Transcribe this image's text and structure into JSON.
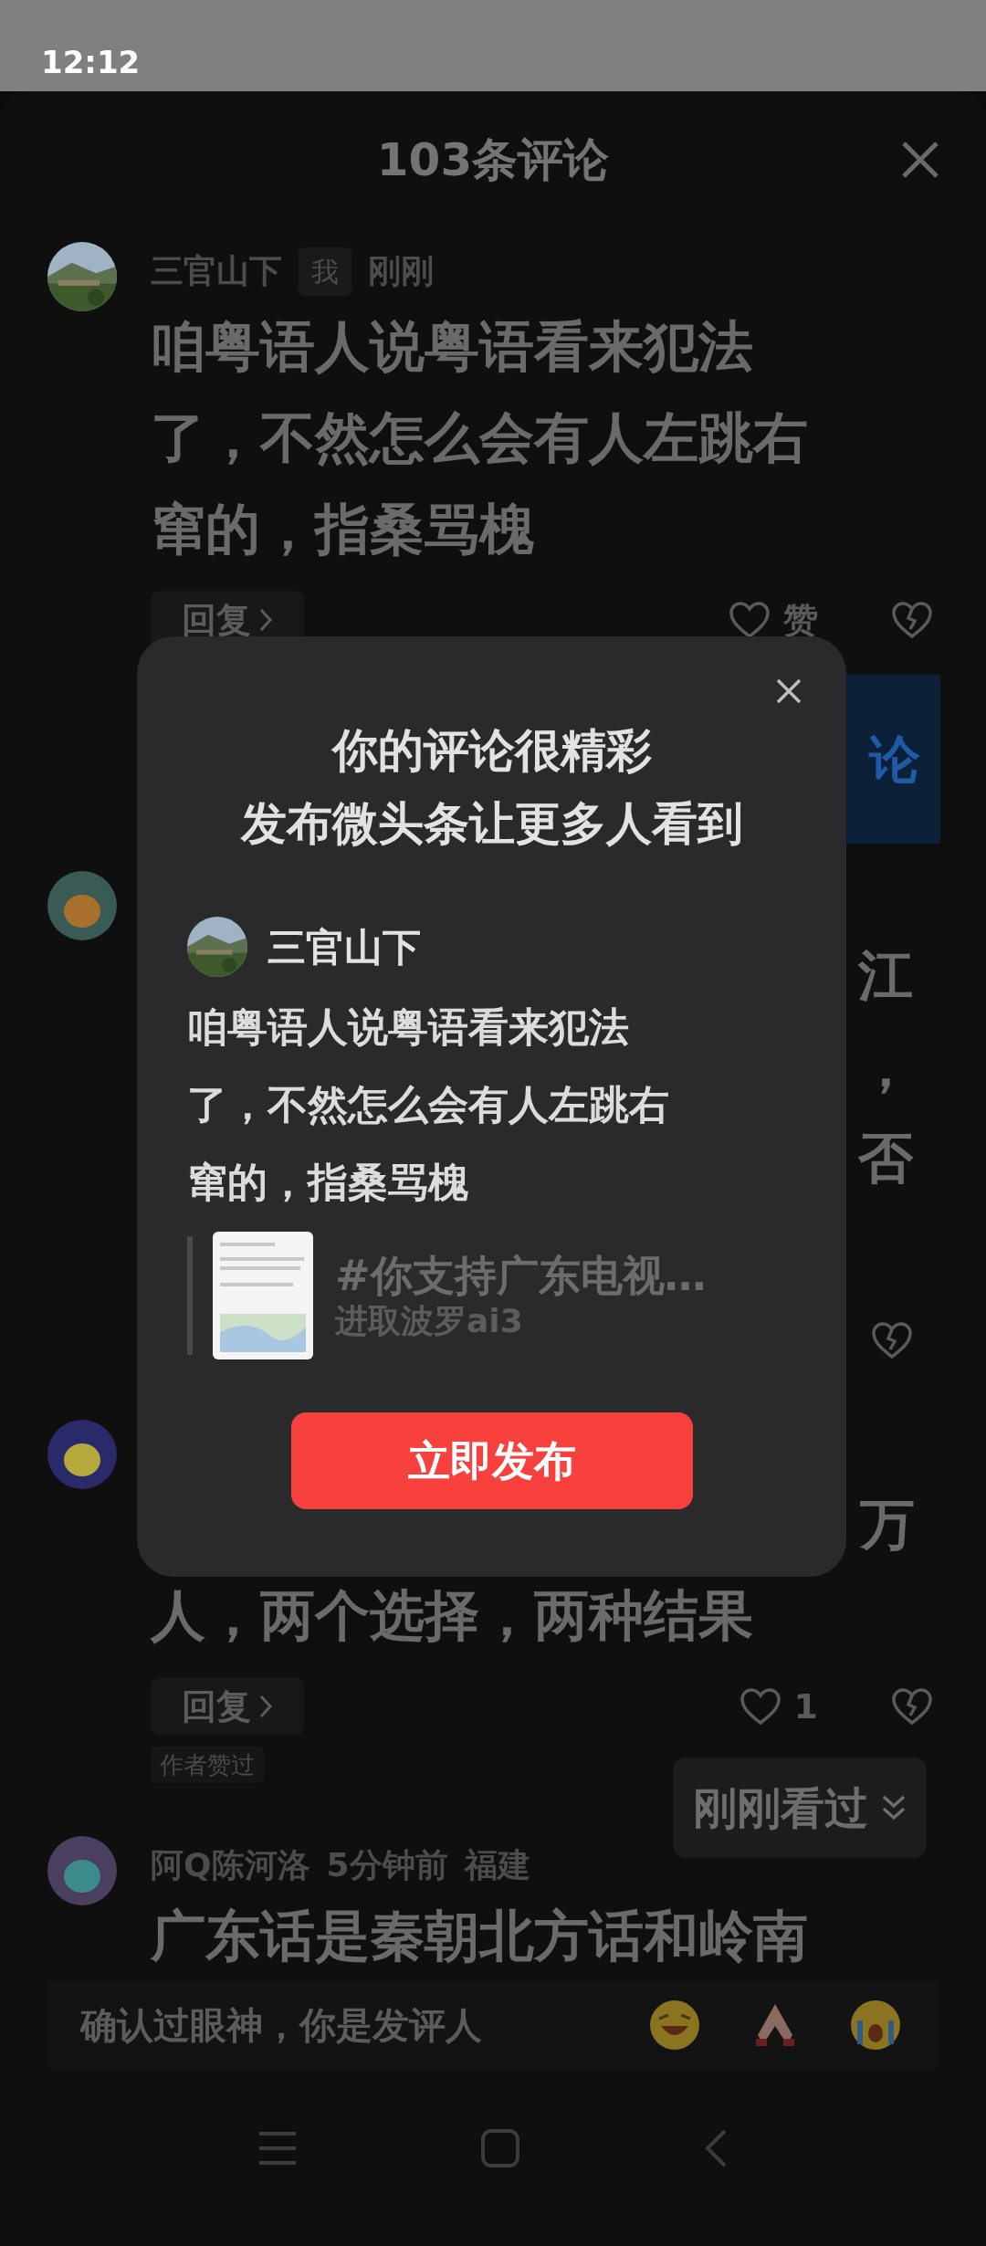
{
  "status_bar": {
    "time": "12:12"
  },
  "header": {
    "title": "103条评论"
  },
  "comments": [
    {
      "kind": "comment",
      "user": "三官山下",
      "badge": "我",
      "time": "刚刚",
      "lines": [
        "咱粤语人说粤语看来犯法",
        "了，不然怎么会有人左跳右",
        "窜的，指桑骂槐"
      ],
      "reply": "回复",
      "like": "赞"
    },
    {
      "kind": "banner",
      "text": "论"
    },
    {
      "kind": "covered",
      "fragments": [
        "江",
        "，",
        "否"
      ]
    },
    {
      "kind": "partial",
      "fragments": [
        "万"
      ],
      "lines": [
        "人，两个选择，两种结果"
      ],
      "reply": "回复",
      "like": "1",
      "tag": "作者赞过"
    },
    {
      "kind": "cut",
      "user": "阿Q陈河洛",
      "time": "5分钟前",
      "location": "福建",
      "lines": [
        "广东话是秦朝北方话和岭南"
      ]
    }
  ],
  "seen_button": {
    "label": "刚刚看过"
  },
  "input_bar": {
    "placeholder": "确认过眼神，你是发评人"
  },
  "dialog": {
    "title_lines": [
      "你的评论很精彩",
      "发布微头条让更多人看到"
    ],
    "user": "三官山下",
    "lines": [
      "咱粤语人说粤语看来犯法",
      "了，不然怎么会有人左跳右",
      "窜的，指桑骂槐"
    ],
    "topic": "#你支持广东电视…",
    "author": "进取波罗ai3",
    "button": "立即发布"
  }
}
